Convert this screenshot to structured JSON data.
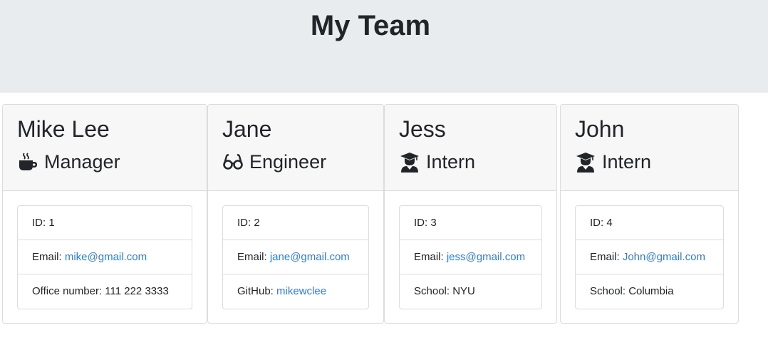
{
  "header": {
    "title": "My Team"
  },
  "cards": [
    {
      "name": "Mike Lee",
      "role": "Manager",
      "role_icon": "mug-icon",
      "id_label": "ID: ",
      "id": "1",
      "email_label": "Email: ",
      "email": "mike@gmail.com",
      "extra_label": "Office number: ",
      "extra_value": "111 222 3333"
    },
    {
      "name": "Jane",
      "role": "Engineer",
      "role_icon": "glasses-icon",
      "id_label": "ID: ",
      "id": "2",
      "email_label": "Email: ",
      "email": "jane@gmail.com",
      "extra_label": "GitHub: ",
      "extra_value": "mikewclee"
    },
    {
      "name": "Jess",
      "role": "Intern",
      "role_icon": "graduate-icon",
      "id_label": "ID: ",
      "id": "3",
      "email_label": "Email: ",
      "email": "jess@gmail.com",
      "extra_label": "School: ",
      "extra_value": "NYU"
    },
    {
      "name": "John",
      "role": "Intern",
      "role_icon": "graduate-icon",
      "id_label": "ID: ",
      "id": "4",
      "email_label": "Email: ",
      "email": "John@gmail.com",
      "extra_label": "School: ",
      "extra_value": "Columbia"
    }
  ]
}
